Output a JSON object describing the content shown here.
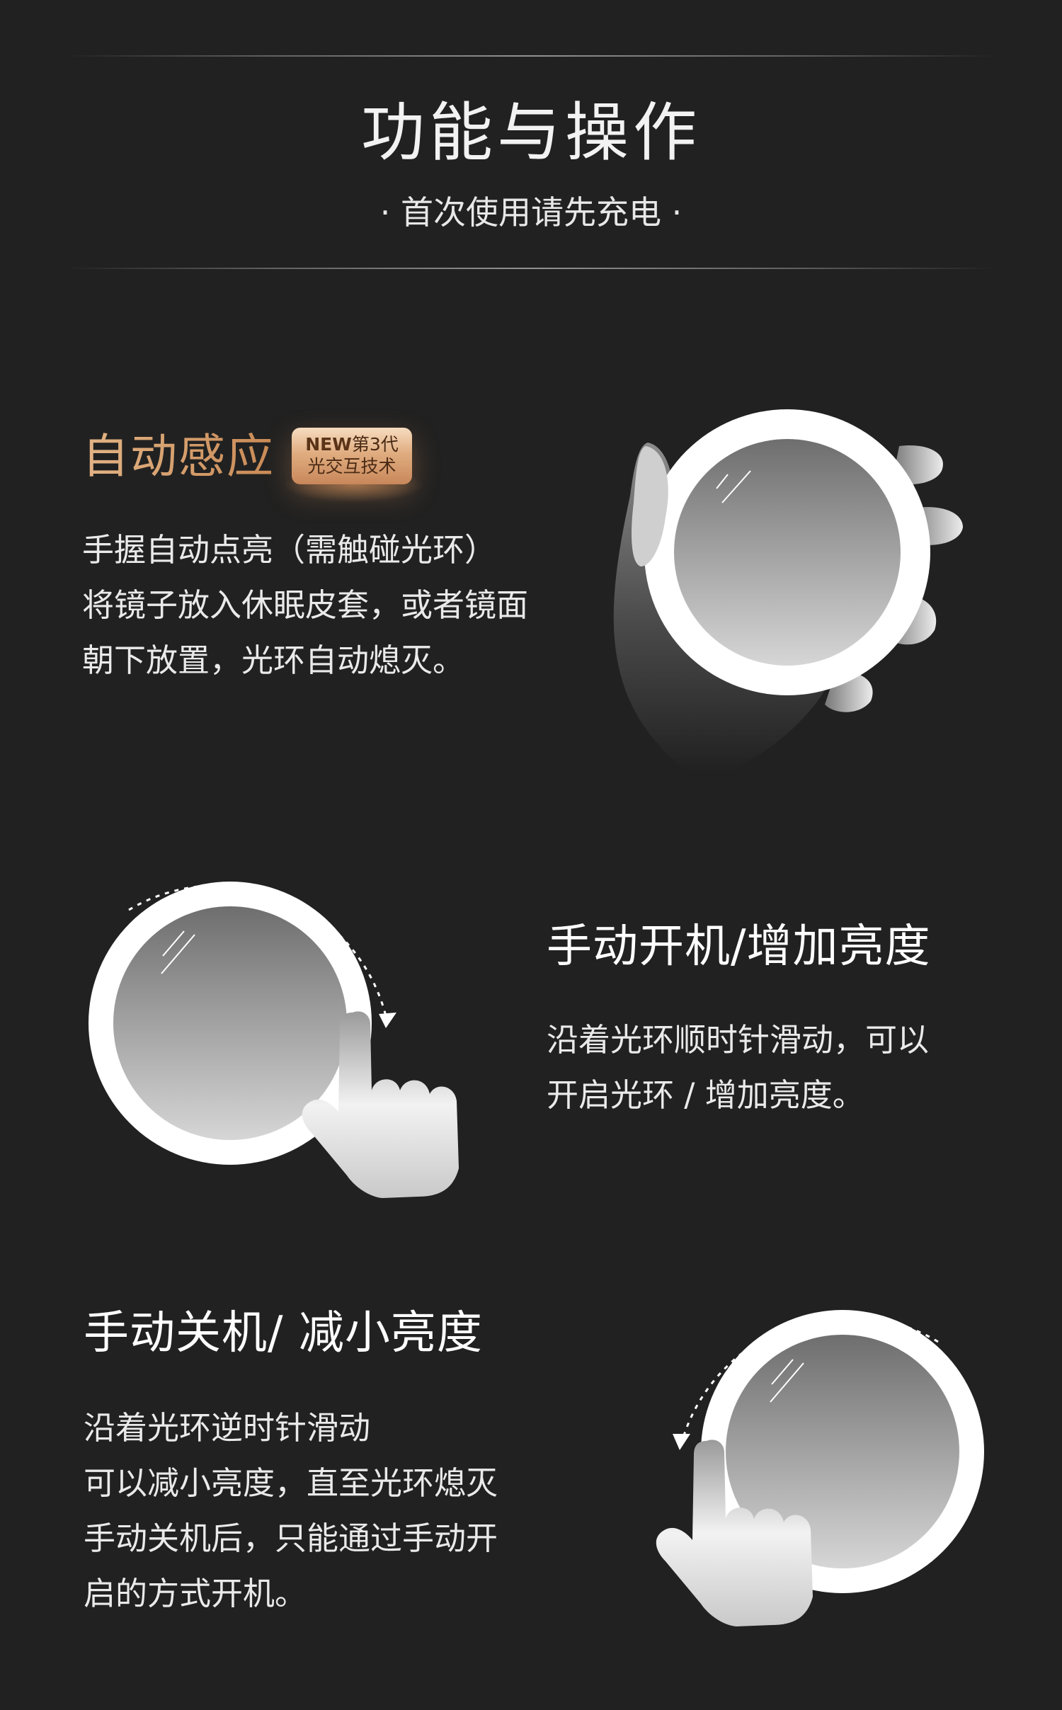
{
  "header": {
    "title": "功能与操作",
    "subtitle": "· 首次使用请先充电 ·"
  },
  "section_auto": {
    "heading": "自动感应",
    "badge": {
      "line1_new": "NEW",
      "line1_rest": "第3代",
      "line2": "光交互技术"
    },
    "lines": [
      "手握自动点亮（需触碰光环）",
      "将镜子放入休眠皮套，或者镜面",
      "朝下放置，光环自动熄灭。"
    ]
  },
  "section_on": {
    "heading": "手动开机/增加亮度",
    "lines": [
      "沿着光环顺时针滑动，可以",
      "开启光环 / 增加亮度。"
    ]
  },
  "section_off": {
    "heading": "手动关机/ 减小亮度",
    "lines": [
      "沿着光环逆时针滑动",
      "可以减小亮度，直至光环熄灭",
      "手动关机后，只能通过手动开",
      "启的方式开机。"
    ]
  },
  "colors": {
    "background": "#212121",
    "gold_heading": "#d9a070",
    "text": "#eaeaea"
  },
  "icons": {
    "hand_holding_mirror": "hand-holding-mirror-illustration",
    "clockwise_swipe": "clockwise-swipe-illustration",
    "counterclockwise_swipe": "counterclockwise-swipe-illustration"
  }
}
